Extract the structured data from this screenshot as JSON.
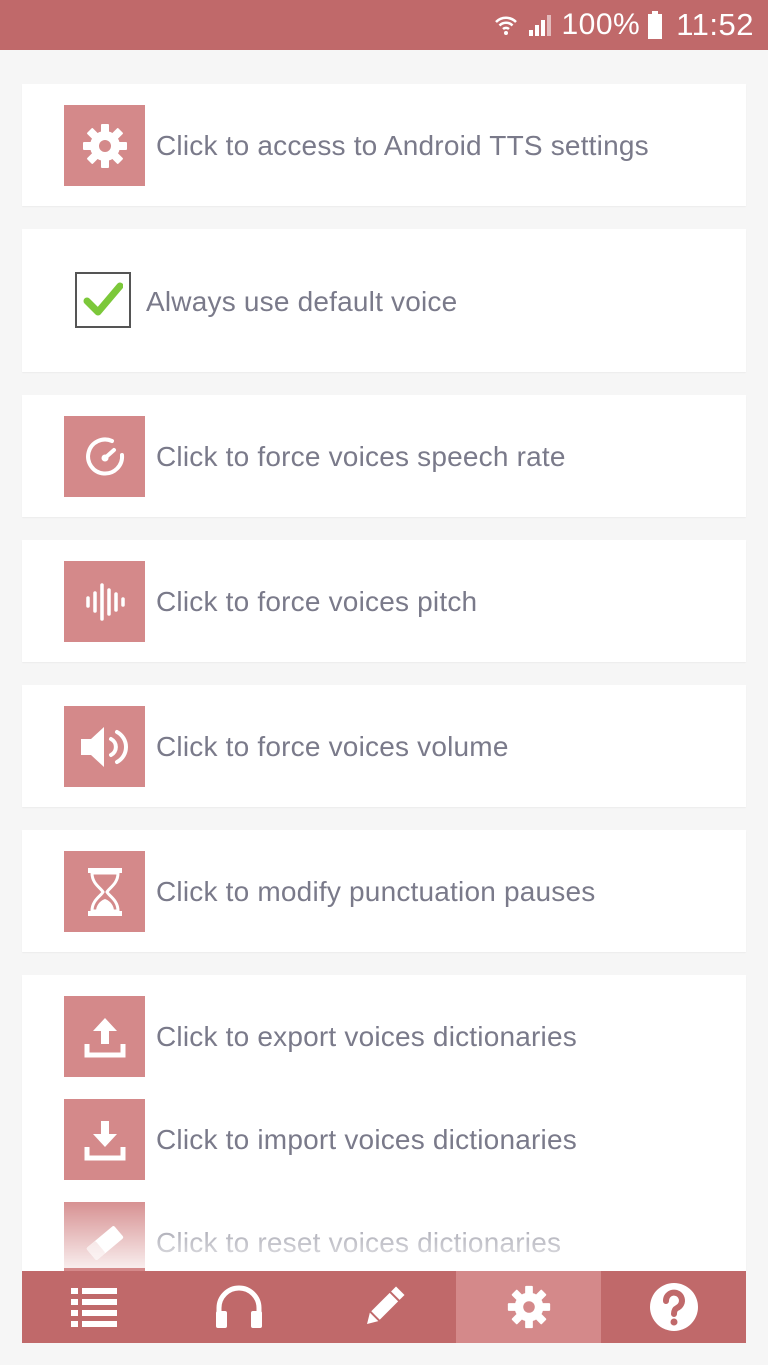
{
  "status_bar": {
    "battery": "100%",
    "time": "11:52",
    "icons": [
      "wifi-icon",
      "signal-icon",
      "battery-icon"
    ]
  },
  "settings": {
    "tts_settings": "Click to access to Android TTS settings",
    "default_voice": {
      "label": "Always use default voice",
      "checked": true
    },
    "speech_rate": "Click to force voices speech rate",
    "pitch": "Click to force voices pitch",
    "volume": "Click to force voices volume",
    "punctuation": "Click to modify punctuation pauses",
    "export_dict": "Click to export voices dictionaries",
    "import_dict": "Click to import voices dictionaries",
    "reset_dict": "Click to reset voices dictionaries"
  },
  "bottom_nav": {
    "items": [
      "list-icon",
      "headphones-icon",
      "pencil-icon",
      "gear-icon",
      "help-icon"
    ],
    "active": "gear-icon"
  },
  "colors": {
    "primary": "#c0696a",
    "icon_bg": "#d4898a",
    "text": "#7a7a8a",
    "check": "#7cc83a"
  }
}
